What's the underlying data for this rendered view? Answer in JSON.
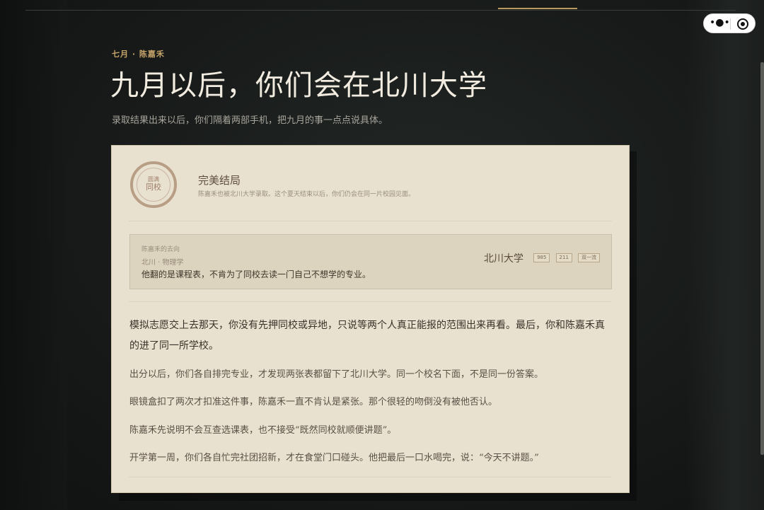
{
  "nav": {
    "tabs": [
      "",
      "",
      "",
      "",
      "",
      "",
      "",
      "",
      "",
      ""
    ]
  },
  "capsule": {
    "more_icon": "more-dots-icon",
    "close_icon": "target-circle-icon"
  },
  "header": {
    "kicker": "七月 · 陈嘉禾",
    "title": "九月以后，你们会在北川大学",
    "subtitle": "录取结果出来以后，你们隔着两部手机，把九月的事一点点说具体。"
  },
  "result": {
    "seal_small": "圆满",
    "seal_big": "同校",
    "title": "完美结局",
    "description": "陈嘉禾也被北川大学录取。这个夏天结束以后，你们仍会在同一片校园见面。"
  },
  "destination": {
    "label": "陈嘉禾的去向",
    "major": "北川 · 物理学",
    "quote": "他翻的是课程表，不肯为了同校去读一门自己不想学的专业。",
    "school": "北川大学",
    "tags": [
      "985",
      "211",
      "双一流"
    ]
  },
  "story": {
    "lead": "模拟志愿交上去那天，你没有先押同校或异地，只说等两个人真正能报的范围出来再看。最后，你和陈嘉禾真的进了同一所学校。",
    "paragraphs": [
      "出分以后，你们各自排完专业，才发现两张表都留下了北川大学。同一个校名下面，不是同一份答案。",
      "眼镜盒扣了两次才扣准这件事，陈嘉禾一直不肯认是紧张。那个很轻的吻倒没有被他否认。",
      "陈嘉禾先说明不会互查选课表，也不接受“既然同校就顺便讲题”。",
      "开学第一周，你们各自忙完社团招新，才在食堂门口碰头。他把最后一口水喝完，说：“今天不讲题。”"
    ]
  },
  "colors": {
    "accent": "#c6a46a",
    "card_bg": "#e9e1d0",
    "page_bg": "#141615"
  }
}
